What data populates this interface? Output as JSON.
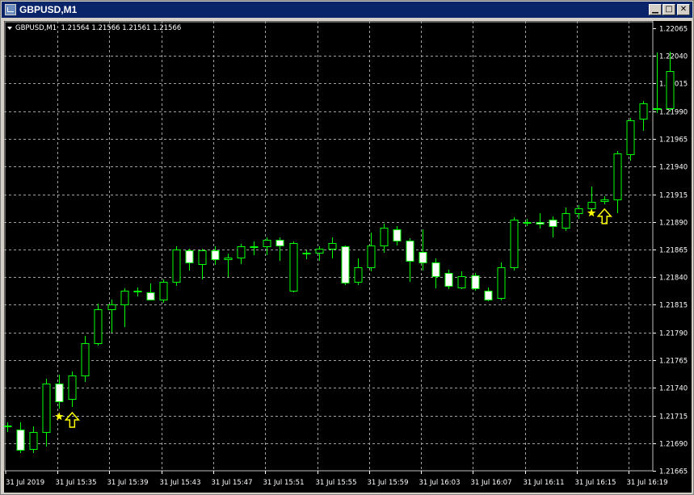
{
  "window": {
    "title": "GBPUSD,M1",
    "buttons": [
      "minimize",
      "maximize",
      "close"
    ]
  },
  "info_line": "GBPUSD,M1  1.21564 1.21566 1.21561 1.21566",
  "colors": {
    "background": "#000000",
    "grid": "#a0a0a0",
    "bull": "#00ff00",
    "bear_fill": "#ffffff",
    "axis_text": "#ffffff",
    "signal": "#ffff00"
  },
  "icons": {
    "window": "chart-app-icon",
    "signal_star": "star-icon",
    "signal_arrow": "up-arrow-icon"
  },
  "chart_data": {
    "type": "candlestick",
    "symbol": "GBPUSD",
    "timeframe": "M1",
    "ylim": [
      1.21665,
      1.22065
    ],
    "y_ticks": [
      "1.22065",
      "1.22040",
      "1.22015",
      "1.21990",
      "1.21965",
      "1.21940",
      "1.21915",
      "1.21890",
      "1.21865",
      "1.21840",
      "1.21815",
      "1.21790",
      "1.21765",
      "1.21740",
      "1.21715",
      "1.21690",
      "1.21665"
    ],
    "x_ticks": [
      "31 Jul 2019",
      "31 Jul 15:35",
      "31 Jul 15:39",
      "31 Jul 15:43",
      "31 Jul 15:47",
      "31 Jul 15:51",
      "31 Jul 15:55",
      "31 Jul 15:59",
      "31 Jul 16:03",
      "31 Jul 16:07",
      "31 Jul 16:11",
      "31 Jul 16:15",
      "31 Jul 16:19"
    ],
    "candles": [
      [
        1.21706,
        1.21705,
        1.21709,
        1.217
      ],
      [
        1.21702,
        1.21684,
        1.21709,
        1.21681
      ],
      [
        1.21685,
        1.217,
        1.21705,
        1.21681
      ],
      [
        1.217,
        1.21744,
        1.21748,
        1.21687
      ],
      [
        1.21744,
        1.21728,
        1.21752,
        1.21721
      ],
      [
        1.2173,
        1.21751,
        1.21755,
        1.21723
      ],
      [
        1.21751,
        1.2178,
        1.21787,
        1.21745
      ],
      [
        1.2178,
        1.21811,
        1.21816,
        1.21778
      ],
      [
        1.21811,
        1.21815,
        1.2182,
        1.2179
      ],
      [
        1.21815,
        1.21828,
        1.2183,
        1.21795
      ],
      [
        1.21828,
        1.21827,
        1.21831,
        1.21823
      ],
      [
        1.21826,
        1.2182,
        1.21834,
        1.21819
      ],
      [
        1.2182,
        1.21836,
        1.21838,
        1.21817
      ],
      [
        1.21836,
        1.21865,
        1.21868,
        1.21832
      ],
      [
        1.21864,
        1.21853,
        1.21866,
        1.21846
      ],
      [
        1.21852,
        1.21864,
        1.21866,
        1.21838
      ],
      [
        1.21864,
        1.21856,
        1.21868,
        1.21851
      ],
      [
        1.21856,
        1.21858,
        1.21861,
        1.2184
      ],
      [
        1.21858,
        1.21868,
        1.2187,
        1.21852
      ],
      [
        1.21868,
        1.21868,
        1.21872,
        1.2186
      ],
      [
        1.21868,
        1.21874,
        1.21876,
        1.2186
      ],
      [
        1.21874,
        1.21869,
        1.21876,
        1.21855
      ],
      [
        1.21828,
        1.21871,
        1.21872,
        1.21826
      ],
      [
        1.21862,
        1.21862,
        1.21864,
        1.21856
      ],
      [
        1.21862,
        1.21866,
        1.21868,
        1.21855
      ],
      [
        1.21866,
        1.21871,
        1.21876,
        1.21857
      ],
      [
        1.21868,
        1.21835,
        1.21869,
        1.21833
      ],
      [
        1.21836,
        1.21849,
        1.21857,
        1.21833
      ],
      [
        1.21849,
        1.21869,
        1.2188,
        1.21845
      ],
      [
        1.21869,
        1.21885,
        1.21888,
        1.21862
      ],
      [
        1.21883,
        1.21873,
        1.21886,
        1.21869
      ],
      [
        1.21873,
        1.21855,
        1.21875,
        1.21836
      ],
      [
        1.21863,
        1.21853,
        1.21883,
        1.21846
      ],
      [
        1.21853,
        1.21841,
        1.21857,
        1.2183
      ],
      [
        1.21844,
        1.21832,
        1.21847,
        1.21829
      ],
      [
        1.21831,
        1.21841,
        1.21845,
        1.21829
      ],
      [
        1.21842,
        1.2183,
        1.21844,
        1.21828
      ],
      [
        1.21828,
        1.2182,
        1.21831,
        1.21818
      ],
      [
        1.21821,
        1.21849,
        1.21853,
        1.21819
      ],
      [
        1.21849,
        1.21892,
        1.21894,
        1.21846
      ],
      [
        1.2189,
        1.2189,
        1.21893,
        1.21886
      ],
      [
        1.2189,
        1.21888,
        1.21898,
        1.21884
      ],
      [
        1.21892,
        1.21886,
        1.21895,
        1.21876
      ],
      [
        1.21885,
        1.21898,
        1.21903,
        1.21882
      ],
      [
        1.21898,
        1.21902,
        1.21905,
        1.21893
      ],
      [
        1.21902,
        1.21908,
        1.21922,
        1.21898
      ],
      [
        1.21909,
        1.2191,
        1.21913,
        1.21906
      ],
      [
        1.2191,
        1.21952,
        1.21954,
        1.21898
      ],
      [
        1.21951,
        1.21982,
        1.21984,
        1.21945
      ],
      [
        1.21983,
        1.21997,
        1.21999,
        1.21972
      ],
      [
        1.21992,
        1.21993,
        1.22043,
        1.21988
      ],
      [
        1.21993,
        1.22026,
        1.22044,
        1.2199
      ]
    ],
    "signals": [
      {
        "type": "star",
        "candle": 4,
        "price": 1.21714
      },
      {
        "type": "buy_arrow",
        "candle": 5,
        "price": 1.21711
      },
      {
        "type": "star",
        "candle": 45,
        "price": 1.21898
      },
      {
        "type": "buy_arrow",
        "candle": 46,
        "price": 1.21895
      }
    ]
  }
}
